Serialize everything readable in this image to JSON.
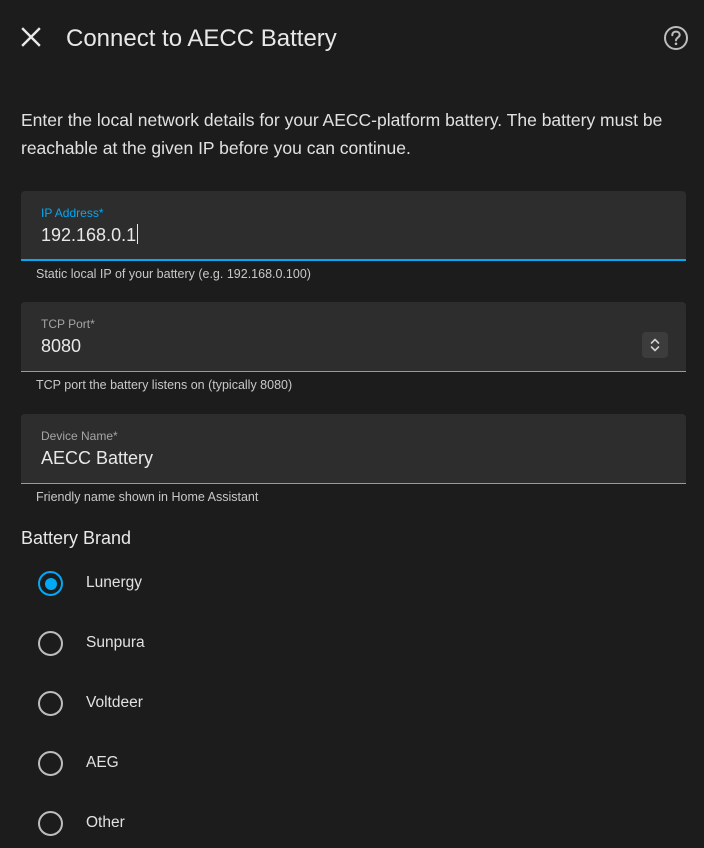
{
  "dialog": {
    "title": "Connect to AECC Battery",
    "close_icon": "close-icon",
    "help_icon": "help-circle-icon",
    "description": "Enter the local network details for your AECC-platform battery. The battery must be reachable at the given IP before you can continue."
  },
  "fields": {
    "ip": {
      "label": "IP Address*",
      "value": "192.168.0.1",
      "helper": "Static local IP of your battery (e.g. 192.168.0.100)"
    },
    "port": {
      "label": "TCP Port*",
      "value": "8080",
      "helper": "TCP port the battery listens on (typically 8080)",
      "stepper_icon": "chevron-up-down-icon"
    },
    "name": {
      "label": "Device Name*",
      "value": "AECC Battery",
      "helper": "Friendly name shown in Home Assistant"
    }
  },
  "brand": {
    "title": "Battery Brand",
    "selected": "Lunergy",
    "options": [
      "Lunergy",
      "Sunpura",
      "Voltdeer",
      "AEG",
      "Other"
    ]
  },
  "colors": {
    "accent": "#03a9f4",
    "background": "#1c1c1c",
    "field_background": "#2d2d2d"
  }
}
